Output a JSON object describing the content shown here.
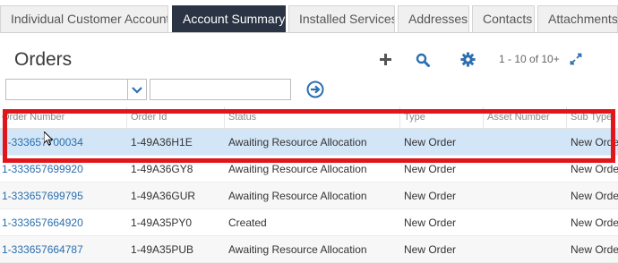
{
  "tabs": [
    {
      "label": "Individual Customer Account",
      "active": false
    },
    {
      "label": "Account Summary",
      "active": true
    },
    {
      "label": "Installed Services",
      "active": false
    },
    {
      "label": "Addresses",
      "active": false
    },
    {
      "label": "Contacts",
      "active": false
    },
    {
      "label": "Attachments",
      "active": false
    }
  ],
  "orders": {
    "title": "Orders",
    "toolbar": {
      "add_icon": "plus-icon",
      "search_icon": "search-icon",
      "settings_icon": "gear-icon",
      "pager": "1 - 10 of 10+",
      "expand_icon": "expand-icon"
    },
    "filter": {
      "field_value": "",
      "query_value": "",
      "go_icon": "arrow-right-circle-icon"
    },
    "columns": [
      "Order Number",
      "Order Id",
      "Status",
      "Type",
      "Asset Number",
      "Sub Type"
    ],
    "rows": [
      {
        "order_number": "1-333657700034",
        "order_id": "1-49A36H1E",
        "status": "Awaiting Resource Allocation",
        "type": "New Order",
        "asset": "",
        "sub_type": "New Order"
      },
      {
        "order_number": "1-333657699920",
        "order_id": "1-49A36GY8",
        "status": "Awaiting Resource Allocation",
        "type": "New Order",
        "asset": "",
        "sub_type": "New Order"
      },
      {
        "order_number": "1-333657699795",
        "order_id": "1-49A36GUR",
        "status": "Awaiting Resource Allocation",
        "type": "New Order",
        "asset": "",
        "sub_type": "New Order"
      },
      {
        "order_number": "1-333657664920",
        "order_id": "1-49A35PY0",
        "status": "Created",
        "type": "New Order",
        "asset": "",
        "sub_type": "New Order"
      },
      {
        "order_number": "1-333657664787",
        "order_id": "1-49A35PUB",
        "status": "Awaiting Resource Allocation",
        "type": "New Order",
        "asset": "",
        "sub_type": "New Order"
      }
    ]
  },
  "colors": {
    "accent": "#2c6fae",
    "tab_active": "#2b3444",
    "highlight": "#e0161b",
    "selected_row": "#d3e6f7"
  }
}
